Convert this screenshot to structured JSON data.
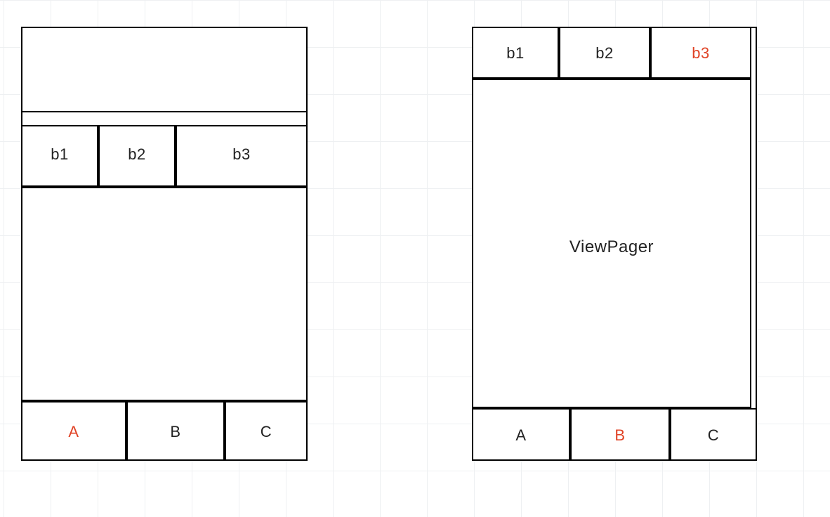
{
  "left": {
    "tabs": {
      "b1": "b1",
      "b2": "b2",
      "b3": "b3"
    },
    "content": "",
    "bottom": {
      "A": "A",
      "B": "B",
      "C": "C"
    },
    "selected_bottom": "A"
  },
  "right": {
    "tabs": {
      "b1": "b1",
      "b2": "b2",
      "b3": "b3"
    },
    "selected_tab": "b3",
    "content": "ViewPager",
    "bottom": {
      "A": "A",
      "B": "B",
      "C": "C"
    },
    "selected_bottom": "B"
  },
  "colors": {
    "highlight": "#e04326",
    "line": "#000000",
    "grid": "#eef0f2"
  }
}
